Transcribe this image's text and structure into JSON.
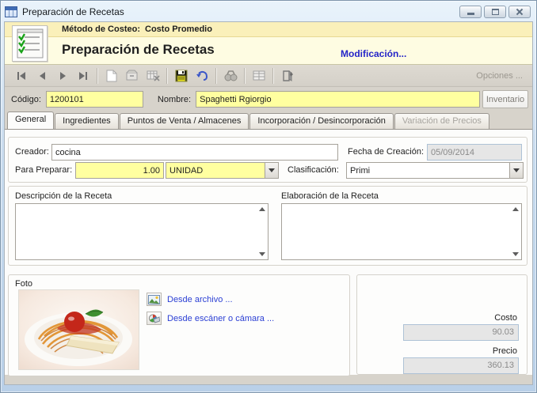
{
  "window": {
    "title": "Preparación de Recetas"
  },
  "header": {
    "costing_label": "Método de Costeo:",
    "costing_value": "Costo Promedio",
    "title": "Preparación de Recetas",
    "mode_text": "Modificación..."
  },
  "toolbar": {
    "options_label": "Opciones ...",
    "buttons": [
      {
        "name": "first-record",
        "enabled": false
      },
      {
        "name": "previous-record",
        "enabled": false
      },
      {
        "name": "next-record",
        "enabled": false
      },
      {
        "name": "last-record",
        "enabled": false
      },
      {
        "name": "new-record",
        "enabled": false
      },
      {
        "name": "edit-record",
        "enabled": false
      },
      {
        "name": "delete-record",
        "enabled": false
      },
      {
        "name": "save",
        "enabled": true
      },
      {
        "name": "undo",
        "enabled": true
      },
      {
        "name": "find",
        "enabled": false
      },
      {
        "name": "grid-view",
        "enabled": false
      },
      {
        "name": "exit",
        "enabled": true
      }
    ]
  },
  "record_bar": {
    "code_label": "Código:",
    "code_value": "1200101",
    "name_label": "Nombre:",
    "name_value": "Spaghetti Rgiorgio",
    "inventory_button": "Inventario"
  },
  "tabs": [
    {
      "label": "General",
      "active": true,
      "enabled": true
    },
    {
      "label": "Ingredientes",
      "active": false,
      "enabled": true
    },
    {
      "label": "Puntos de Venta / Almacenes",
      "active": false,
      "enabled": true
    },
    {
      "label": "Incorporación / Desincorporación",
      "active": false,
      "enabled": true
    },
    {
      "label": "Variación de Precios",
      "active": false,
      "enabled": false
    }
  ],
  "general": {
    "creator_label": "Creador:",
    "creator_value": "cocina",
    "creation_date_label": "Fecha de Creación:",
    "creation_date_value": "05/09/2014",
    "prepare_label": "Para Preparar:",
    "prepare_qty": "1.00",
    "prepare_unit": "UNIDAD",
    "classification_label": "Clasificación:",
    "classification_value": "Primi",
    "description_label": "Descripción de la Receta",
    "description_value": "",
    "elaboration_label": "Elaboración de la Receta",
    "elaboration_value": "",
    "photo": {
      "label": "Foto",
      "from_file_link": "Desde archivo ...",
      "from_scanner_link": "Desde escáner o cámara ..."
    },
    "totals": {
      "cost_label": "Costo",
      "cost_value": "90.03",
      "price_label": "Precio",
      "price_value": "360.13"
    }
  },
  "colors": {
    "field_highlight": "#ffffa0",
    "header_band": "#faf0ba",
    "header_bg": "#fefce2",
    "link_blue": "#2b3fd4",
    "mode_blue": "#2424c8",
    "disabled_field_bg": "#e6e6e6",
    "disabled_field_border": "#aec2d6"
  }
}
